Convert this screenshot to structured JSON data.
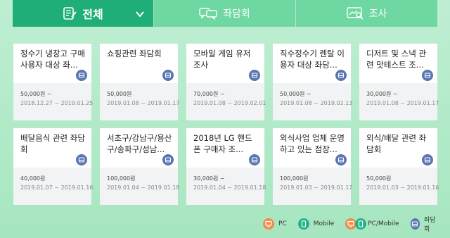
{
  "tabs": [
    {
      "label": "전체",
      "icon": "survey-list-icon"
    },
    {
      "label": "좌담회",
      "icon": "chat-bubbles-icon"
    },
    {
      "label": "조사",
      "icon": "chart-search-icon"
    }
  ],
  "cards": [
    {
      "title": "정수기 냉장고 구매사용자 대상 좌...",
      "price": "50,000원 ~",
      "date": "2018.12.27 ~ 2019.01.25",
      "type": "좌담회"
    },
    {
      "title": "쇼핑관련 좌담회",
      "price": "50,000원",
      "date": "2019.01.08 ~ 2019.01.17",
      "type": "좌담회"
    },
    {
      "title": "모바일 게임 유저 조사",
      "price": "70,000원 ~",
      "date": "2019.01.08 ~ 2019.02.01",
      "type": "좌담회"
    },
    {
      "title": "직수정수기 렌탈 이용자 대상 좌담...",
      "price": "50,000원 ~",
      "date": "2019.01.08 ~ 2019.02.13",
      "type": "좌담회"
    },
    {
      "title": "디저트 및 스낵 관련 맛테스트 조...",
      "price": "30,000원 ~",
      "date": "2019.01.08 ~ 2019.01.17",
      "type": "좌담회"
    },
    {
      "title": "배달음식 관련 좌담회",
      "price": "40,000원",
      "date": "2019.01.07 ~ 2019.01.16",
      "type": "좌담회"
    },
    {
      "title": "서초구/강남구/용산구/송파구/성남...",
      "price": "100,000원",
      "date": "2019.01.04 ~ 2019.01.18",
      "type": "좌담회"
    },
    {
      "title": "2018년 LG 핸드폰 구매자 조...",
      "price": "30,000원 ~",
      "date": "2019.01.04 ~ 2019.01.18",
      "type": "좌담회"
    },
    {
      "title": "외식사업 업체 운영하고 있는 점장...",
      "price": "100,000원",
      "date": "2019.01.03 ~ 2019.01.17",
      "type": "좌담회"
    },
    {
      "title": "외식/배달 관련 좌담회",
      "price": "50,000원",
      "date": "2019.01.03 ~ 2019.01.16",
      "type": "좌담회"
    }
  ],
  "legend": [
    {
      "label": "PC",
      "icon": "pc-icon",
      "color": "#f28a4b"
    },
    {
      "label": "Mobile",
      "icon": "mobile-icon",
      "color": "#22b38a"
    },
    {
      "label": "PC/Mobile",
      "icon": "pc-mobile-icon"
    },
    {
      "label": "좌담회",
      "icon": "chat-room-icon",
      "color": "#5a76b0"
    }
  ]
}
